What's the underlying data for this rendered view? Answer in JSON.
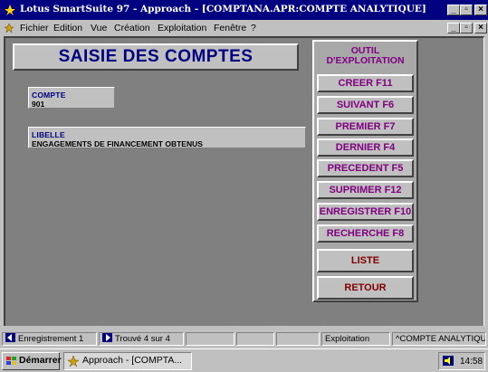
{
  "window": {
    "title": "Lotus SmartSuite 97  - Approach - [COMPTANA.APR:COMPTE ANALYTIQUE]"
  },
  "menu": {
    "items": [
      {
        "label": "Fichier"
      },
      {
        "label": "Edition"
      },
      {
        "label": "Vue"
      },
      {
        "label": "Création"
      },
      {
        "label": "Exploitation"
      },
      {
        "label": "Fenêtre"
      },
      {
        "label": "?"
      }
    ]
  },
  "form": {
    "title": "SAISIE DES COMPTES",
    "compte": {
      "label": "COMPTE",
      "value": "901"
    },
    "libelle": {
      "label": "LIBELLE",
      "value": "ENGAGEMENTS DE FINANCEMENT OBTENUS"
    }
  },
  "panel": {
    "title_line1": "OUTIL",
    "title_line2": "D'EXPLOITATION",
    "buttons": [
      {
        "label": "CREER F11"
      },
      {
        "label": "SUIVANT F6"
      },
      {
        "label": "PREMIER F7"
      },
      {
        "label": "DERNIER F4"
      },
      {
        "label": "PRECEDENT F5"
      },
      {
        "label": "SUPRIMER F12"
      },
      {
        "label": "ENREGISTRER F10"
      },
      {
        "label": "RECHERCHE F8"
      },
      {
        "label": "LISTE"
      },
      {
        "label": "RETOUR"
      }
    ]
  },
  "statusbar": {
    "record": "Enregistrement 1",
    "found": "Trouvé 4 sur 4",
    "mode": "Exploitation",
    "view": "^COMPTE ANALYTIQUE^"
  },
  "taskbar": {
    "start_label": "Démarrer",
    "app_label": "Approach - [COMPTA...",
    "clock": "14:58"
  },
  "colors": {
    "titlebar": "#000080",
    "form_title_text": "#000080",
    "button_text": "#800080",
    "canvas": "#808080"
  }
}
